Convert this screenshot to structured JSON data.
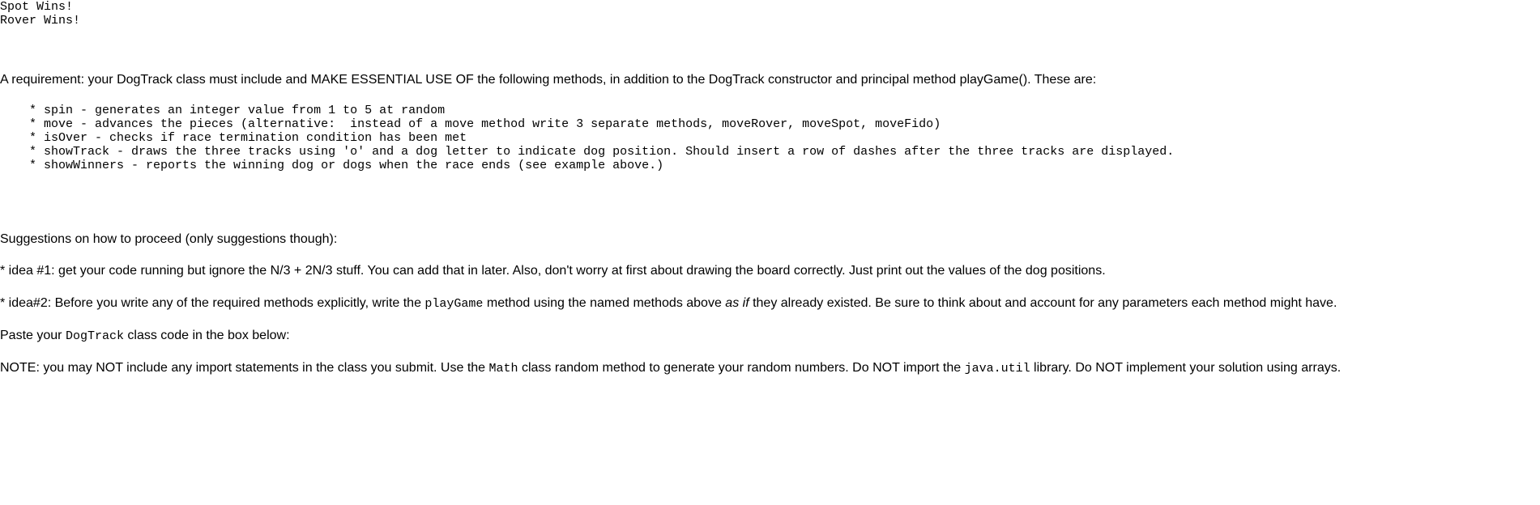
{
  "output": {
    "line1": "Spot Wins!",
    "line2": "Rover Wins!"
  },
  "requirement": {
    "intro_before_class": "A requirement: your ",
    "class_name": "DogTrack",
    "intro_after_class": " class must include and MAKE ESSENTIAL USE OF the following methods, in addition to the DogTrack constructor and principal method playGame(). These are:"
  },
  "methods_block": "    * spin - generates an integer value from 1 to 5 at random\n    * move - advances the pieces (alternative:  instead of a move method write 3 separate methods, moveRover, moveSpot, moveFido)\n    * isOver - checks if race termination condition has been met\n    * showTrack - draws the three tracks using 'o' and a dog letter to indicate dog position. Should insert a row of dashes after the three tracks are displayed.\n    * showWinners - reports the winning dog or dogs when the race ends (see example above.)",
  "suggestions": {
    "heading": "Suggestions on how to proceed (only suggestions though):",
    "idea1": "* idea #1: get your code running but ignore the N/3 + 2N/3 stuff. You can add that in later. Also, don't worry at first about drawing the board correctly. Just print out the values of the dog positions.",
    "idea2_pre": "* idea#2: Before you write any of the required methods explicitly, write the ",
    "idea2_code": "playGame",
    "idea2_mid": " method using the named methods above ",
    "idea2_em": "as if",
    "idea2_post": " they already existed. Be sure to think about and account for any parameters each method might have."
  },
  "paste": {
    "pre": "Paste your ",
    "code": "DogTrack",
    "post": " class code in the box below:"
  },
  "note": {
    "pre": "NOTE: you may NOT include any import statements in the class you submit. Use the ",
    "code1": "Math",
    "mid": " class random method to generate your random numbers. Do NOT import the ",
    "code2": "java.util",
    "post": " library. Do NOT implement your solution using arrays."
  }
}
